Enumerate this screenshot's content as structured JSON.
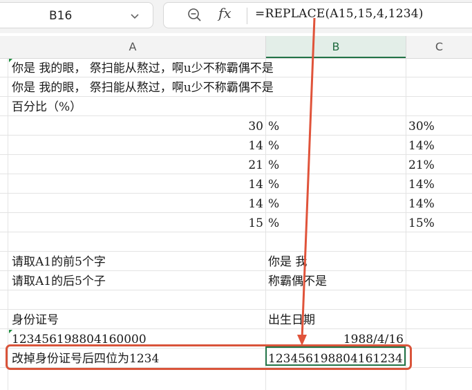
{
  "formula_bar": {
    "name_box": "B16",
    "formula": "=REPLACE(A15,15,4,1234)",
    "icons": {
      "name_box_dropdown": "chevron-down-icon",
      "zoom": "zoom-out-icon",
      "function": "fx-icon"
    },
    "fx_label": "fx"
  },
  "columns": [
    {
      "label": "A",
      "selected": false
    },
    {
      "label": "B",
      "selected": true
    },
    {
      "label": "C",
      "selected": false
    }
  ],
  "cells": {
    "row1": {
      "a": " 你是  我的眼，  祭扫能从熬过，啊u少不称霸偶不是"
    },
    "row2": {
      "a": "你是  我的眼，  祭扫能从熬过，啊u少不称霸偶不是"
    },
    "row3": {
      "a": "百分比（%）"
    },
    "pct_rows": [
      {
        "a": "30",
        "b": "%",
        "c": "30%"
      },
      {
        "a": "14",
        "b": "%",
        "c": "14%"
      },
      {
        "a": "21",
        "b": "%",
        "c": "21%"
      },
      {
        "a": "14",
        "b": "%",
        "c": "14%"
      },
      {
        "a": "14",
        "b": "%",
        "c": "14%"
      },
      {
        "a": "15",
        "b": "%",
        "c": "15%"
      }
    ],
    "row11": {
      "a": "请取A1的前5个字",
      "b": " 你是  我"
    },
    "row12": {
      "a": "请取A1的后5个子",
      "b": "称霸偶不是"
    },
    "row14": {
      "a": "身份证号",
      "b": "出生日期"
    },
    "row15": {
      "a": "123456198804160000",
      "b": "1988/4/16"
    },
    "row16": {
      "a": "改掉身份证号后四位为1234",
      "b": "123456198804161234"
    }
  },
  "annotation": {
    "color": "#d9543a"
  },
  "colors": {
    "accent": "#217346",
    "header_bg": "#f3f3f3",
    "grid": "#e3e3e3"
  }
}
